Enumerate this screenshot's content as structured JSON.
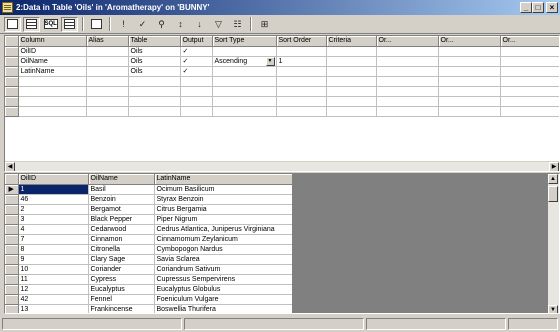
{
  "window": {
    "title": "2:Data in Table 'Oils' in 'Aromatherapy' on 'BUNNY'",
    "minimize_glyph": "_",
    "maximize_glyph": "□",
    "close_glyph": "×"
  },
  "toolbar": {
    "buttons": [
      {
        "name": "show-diagram-pane",
        "icon": "diagram-icon"
      },
      {
        "name": "show-grid-pane",
        "icon": "grid-icon"
      },
      {
        "name": "show-sql-pane",
        "icon": "sql-icon",
        "label": "SQL"
      },
      {
        "name": "show-results-pane",
        "icon": "results-icon"
      },
      {
        "name": "change-query-type",
        "icon": "query-type-icon"
      },
      {
        "name": "run-query",
        "icon": "run-icon",
        "glyph": "!"
      },
      {
        "name": "verify-sql",
        "icon": "verify-icon",
        "glyph": "✓"
      },
      {
        "name": "remove-filter",
        "icon": "remove-filter-icon",
        "glyph": "⚲"
      },
      {
        "name": "sort-ascending",
        "icon": "sort-ascending-icon",
        "glyph": "↕"
      },
      {
        "name": "sort-descending",
        "icon": "sort-descending-icon",
        "glyph": "↓"
      },
      {
        "name": "auto-filter",
        "icon": "filter-icon",
        "glyph": "▽"
      },
      {
        "name": "properties",
        "icon": "properties-icon",
        "glyph": "☷"
      },
      {
        "name": "group-by",
        "icon": "group-by-icon",
        "glyph": "⊞"
      }
    ]
  },
  "criteria_grid": {
    "headers": [
      "Column",
      "Alias",
      "Table",
      "Output",
      "Sort Type",
      "Sort Order",
      "Criteria",
      "Or...",
      "Or...",
      "Or..."
    ],
    "rows": [
      {
        "column": "OilID",
        "alias": "",
        "table": "Oils",
        "output": "✓",
        "sort_type": "",
        "sort_order": ""
      },
      {
        "column": "OilName",
        "alias": "",
        "table": "Oils",
        "output": "✓",
        "sort_type": "Ascending",
        "sort_order": "1"
      },
      {
        "column": "LatinName",
        "alias": "",
        "table": "Oils",
        "output": "✓",
        "sort_type": "",
        "sort_order": ""
      },
      {
        "column": "",
        "alias": "",
        "table": "",
        "output": "",
        "sort_type": "",
        "sort_order": ""
      },
      {
        "column": "",
        "alias": "",
        "table": "",
        "output": "",
        "sort_type": "",
        "sort_order": ""
      },
      {
        "column": "",
        "alias": "",
        "table": "",
        "output": "",
        "sort_type": "",
        "sort_order": ""
      },
      {
        "column": "",
        "alias": "",
        "table": "",
        "output": "",
        "sort_type": "",
        "sort_order": ""
      }
    ]
  },
  "results_grid": {
    "headers": [
      "OilID",
      "OilName",
      "LatinName"
    ],
    "current_row_marker": "▶",
    "rows": [
      {
        "id": "1",
        "name": "Basil",
        "latin": "Ocimum Basilicum"
      },
      {
        "id": "46",
        "name": "Benzoin",
        "latin": "Styrax Benzoin"
      },
      {
        "id": "2",
        "name": "Bergamot",
        "latin": "Citrus Bergamia"
      },
      {
        "id": "3",
        "name": "Black Pepper",
        "latin": "Piper Nigrum"
      },
      {
        "id": "4",
        "name": "Cedarwood",
        "latin": "Cedrus Atlantica, Juniperus Virginiana"
      },
      {
        "id": "7",
        "name": "Cinnamon",
        "latin": "Cinnamomum Zeylanicum"
      },
      {
        "id": "8",
        "name": "Citronella",
        "latin": "Cymbopogon Nardus"
      },
      {
        "id": "9",
        "name": "Clary Sage",
        "latin": "Savia Sclarea"
      },
      {
        "id": "10",
        "name": "Coriander",
        "latin": "Coriandrum Sativum"
      },
      {
        "id": "11",
        "name": "Cypress",
        "latin": "Cupressus Sempervirens"
      },
      {
        "id": "12",
        "name": "Eucalyptus",
        "latin": "Eucalyptus Globulus"
      },
      {
        "id": "42",
        "name": "Fennel",
        "latin": "Foeniculum Vulgare"
      },
      {
        "id": "13",
        "name": "Frankincense",
        "latin": "Boswellia Thurifera"
      }
    ]
  },
  "scroll": {
    "up_glyph": "▲",
    "down_glyph": "▼",
    "left_glyph": "◀",
    "right_glyph": "▶"
  },
  "colors": {
    "title_gradient_start": "#0a246a",
    "title_gradient_end": "#a6caf0",
    "selection": "#0a246a",
    "chrome": "#d4d0c8"
  }
}
